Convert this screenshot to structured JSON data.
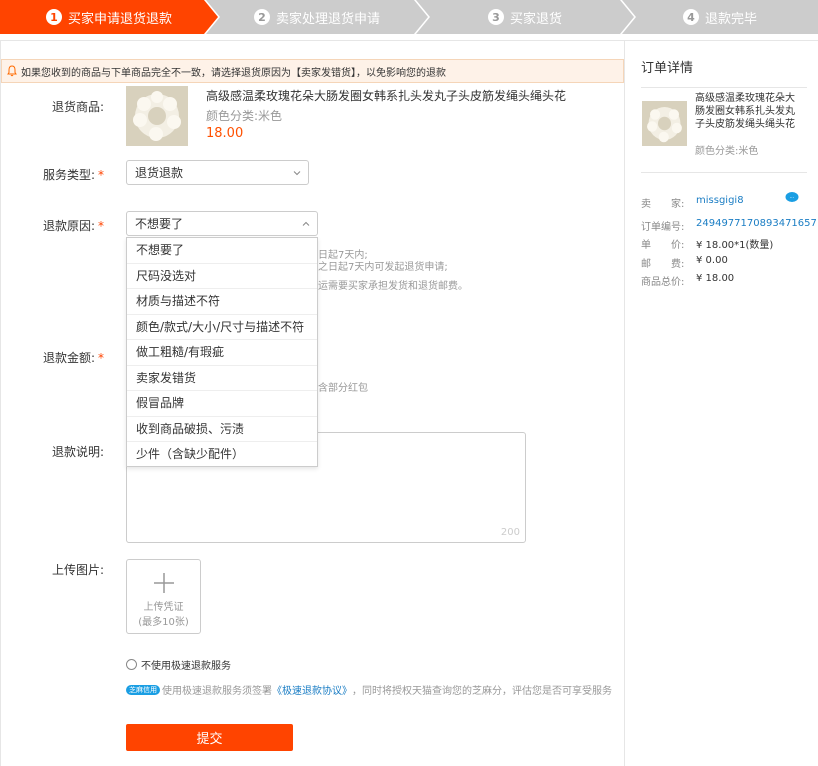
{
  "steps": [
    {
      "num": "1",
      "label": "买家申请退货退款"
    },
    {
      "num": "2",
      "label": "卖家处理退货申请"
    },
    {
      "num": "3",
      "label": "买家退货"
    },
    {
      "num": "4",
      "label": "退款完毕"
    }
  ],
  "notice": "如果您收到的商品与下单商品完全不一致，请选择退货原因为【卖家发错货】，以免影响您的退款",
  "form": {
    "product_label": "退货商品:",
    "product_title": "高级感温柔玫瑰花朵大肠发圈女韩系扎头发丸子头皮筋发绳头绳头花",
    "product_sku": "颜色分类:米色",
    "product_price": "18.00",
    "service_label": "服务类型:",
    "service_value": "退货退款",
    "reason_label": "退款原因:",
    "reason_value": "不想要了",
    "reason_options": [
      "不想要了",
      "尺码没选对",
      "材质与描述不符",
      "颜色/款式/大小/尺寸与描述不符",
      "做工粗糙/有瑕疵",
      "卖家发错货",
      "假冒品牌",
      "收到商品破损、污渍",
      "少件（含缺少配件）"
    ],
    "hint_line1": "日起7天内;",
    "hint_line2": "之日起7天内可发起退货申请;",
    "hint_line3": "运需要买家承担发货和退货邮费。",
    "amount_label": "退款金额:",
    "amount_hint": "含部分红包",
    "desc_label": "退款说明:",
    "desc_count": "200",
    "upload_label": "上传图片:",
    "upload_text1": "上传凭证",
    "upload_text2": "(最多10张)",
    "fast_refund_label": "不使用极速退款服务",
    "zhima_badge": "芝麻信用",
    "agree_prefix": "使用极速退款服务须签署",
    "agree_link": "《极速退款协议》",
    "agree_suffix": "，同时将授权天猫查询您的芝麻分，评估您是否可享受服务",
    "submit_label": "提交"
  },
  "order": {
    "title": "订单详情",
    "product_title": "高级感温柔玫瑰花朵大肠发圈女韩系扎头发丸子头皮筋发绳头绳头花",
    "product_sku": "颜色分类:米色",
    "seller_key": "卖　　家:",
    "seller_val": "missgigi8",
    "order_no_key": "订单编号:",
    "order_no_val": "2494977170893471657",
    "unit_price_key": "单　　价:",
    "unit_price_val": "¥ 18.00*1(数量)",
    "postage_key": "邮　　费:",
    "postage_val": "¥ 0.00",
    "total_key": "商品总价:",
    "total_val": "¥ 18.00"
  },
  "colors": {
    "accent": "#ff4400",
    "step_inactive": "#cccccc",
    "link": "#1a7dc4"
  }
}
